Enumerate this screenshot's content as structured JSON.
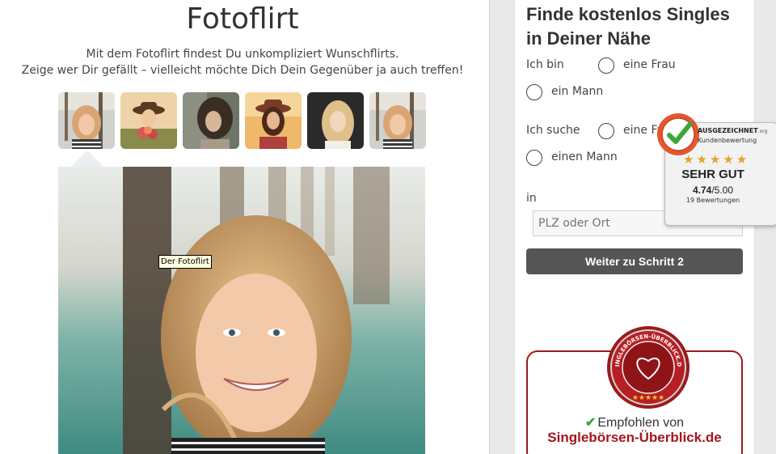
{
  "header": {
    "title": "Fotoflirt",
    "intro_line1": "Mit dem Fotoflirt findest Du unkompliziert Wunschflirts.",
    "intro_line2": "Zeige wer Dir gefällt – vielleicht möchte Dich Dein Gegenüber ja auch treffen!"
  },
  "gallery": {
    "thumbnails": [
      {
        "name": "thumb-blonde-pier",
        "colors": [
          "#c9c4b6",
          "#d9a574",
          "#6b5a45"
        ]
      },
      {
        "name": "thumb-hat-flowers",
        "colors": [
          "#e9c9a0",
          "#c74a4a",
          "#6b6b2e"
        ]
      },
      {
        "name": "thumb-curly-hair",
        "colors": [
          "#5a6058",
          "#3a2d24",
          "#a89a88"
        ]
      },
      {
        "name": "thumb-hat-sunset",
        "colors": [
          "#f0b86a",
          "#7a3a2a",
          "#b04040"
        ]
      },
      {
        "name": "thumb-blonde-smile",
        "colors": [
          "#2a2a2a",
          "#e0c08a",
          "#f3d7bd"
        ]
      },
      {
        "name": "thumb-blonde-pier-2",
        "colors": [
          "#c9c4b6",
          "#d9a574",
          "#6b5a45"
        ]
      }
    ],
    "tooltip": "Der Fotoflirt"
  },
  "signup": {
    "title": "Finde kostenlos Singles in Deiner Nähe",
    "i_am_label": "Ich bin",
    "i_am_options": [
      "eine Frau",
      "ein Mann"
    ],
    "looking_for_label": "Ich suche",
    "looking_for_options": [
      "eine Frau",
      "einen Mann"
    ],
    "in_label": "in",
    "location_placeholder": "PLZ oder Ort",
    "submit_label": "Weiter zu Schritt 2"
  },
  "rating_widget": {
    "brand": "AUSGEZEICHNET",
    "brand_suffix": ".org",
    "subtitle": "Kundenbewertung",
    "grade": "SEHR GUT",
    "score": "4.74",
    "score_max": "/5.00",
    "count": "19 Bewertungen",
    "stars": 4.74,
    "star_color": "#e3a22b",
    "seal_text": "AUSGEZEICHNET"
  },
  "recommendation": {
    "line1": "Empfohlen von",
    "line2": "Singlebörsen-Überblick.de",
    "badge_text": "SINGLEBÖRSEN-ÜBERBLICK.DE",
    "accent": "#a4161a"
  }
}
